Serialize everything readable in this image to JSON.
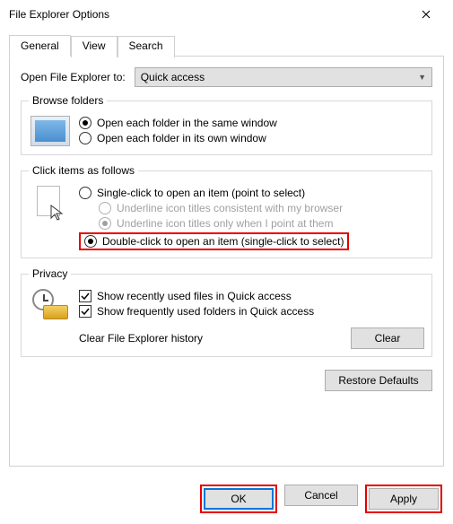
{
  "window": {
    "title": "File Explorer Options"
  },
  "tabs": {
    "general": "General",
    "view": "View",
    "search": "Search"
  },
  "open_to": {
    "label": "Open File Explorer to:",
    "value": "Quick access"
  },
  "browse": {
    "legend": "Browse folders",
    "same": "Open each folder in the same window",
    "own": "Open each folder in its own window"
  },
  "click": {
    "legend": "Click items as follows",
    "single": "Single-click to open an item (point to select)",
    "underline_browser": "Underline icon titles consistent with my browser",
    "underline_point": "Underline icon titles only when I point at them",
    "double": "Double-click to open an item (single-click to select)"
  },
  "privacy": {
    "legend": "Privacy",
    "recent": "Show recently used files in Quick access",
    "frequent": "Show frequently used folders in Quick access",
    "clear_label": "Clear File Explorer history",
    "clear_btn": "Clear"
  },
  "restore": "Restore Defaults",
  "footer": {
    "ok": "OK",
    "cancel": "Cancel",
    "apply": "Apply"
  }
}
